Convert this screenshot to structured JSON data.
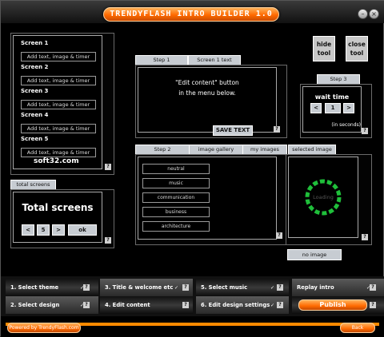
{
  "app": {
    "title": "TRENDYFLASH INTRO BUILDER 1.0",
    "help_label": "?"
  },
  "window_controls": [
    "minimize-icon",
    "close-icon"
  ],
  "tools": {
    "hide_label": "hide\ntool",
    "close_label": "close\ntool"
  },
  "screens_panel": {
    "items": [
      {
        "label": "Screen 1",
        "field": "Add text, image & timer"
      },
      {
        "label": "Screen 2",
        "field": "Add text, image & timer"
      },
      {
        "label": "Screen 3",
        "field": "Add text, image & timer"
      },
      {
        "label": "Screen 4",
        "field": "Add text, image & timer"
      },
      {
        "label": "Screen 5",
        "field": "Add text, image & timer"
      }
    ],
    "watermark": "soft32.com"
  },
  "total_screens": {
    "tab": "total screens",
    "heading": "Total screens",
    "value": "5",
    "prev": "<",
    "next": ">",
    "ok": "ok"
  },
  "step1": {
    "tab": "Step 1",
    "tab2": "Screen 1 text",
    "line1": "\"Edit content\" button",
    "line2": "in the menu below.",
    "save": "SAVE TEXT"
  },
  "step3": {
    "tab": "Step 3",
    "heading": "wait time",
    "prev": "<",
    "value": "1",
    "next": ">",
    "unit": "(in seconds)"
  },
  "step2": {
    "tab": "Step 2",
    "tab2": "image gallery",
    "tab3": "my images",
    "items": [
      "neutral",
      "music",
      "communication",
      "business",
      "architecture"
    ]
  },
  "selected_image": {
    "tab": "selected image",
    "loading": "Loading",
    "no_image": "no image"
  },
  "nav": {
    "row1": [
      "1.  Select theme",
      "3.  Title & welcome etc",
      "5.  Select music",
      "Replay intro"
    ],
    "row2": [
      "2.  Select design",
      "4.  Edit content",
      "6.  Edit design settings",
      "Publish"
    ]
  },
  "footer": {
    "powered": "Powered by TrendyFlash.com",
    "back": "Back"
  },
  "colors": {
    "accent": "#ff7a00",
    "panel_tab": "#c7ccd2",
    "background": "#000000"
  }
}
